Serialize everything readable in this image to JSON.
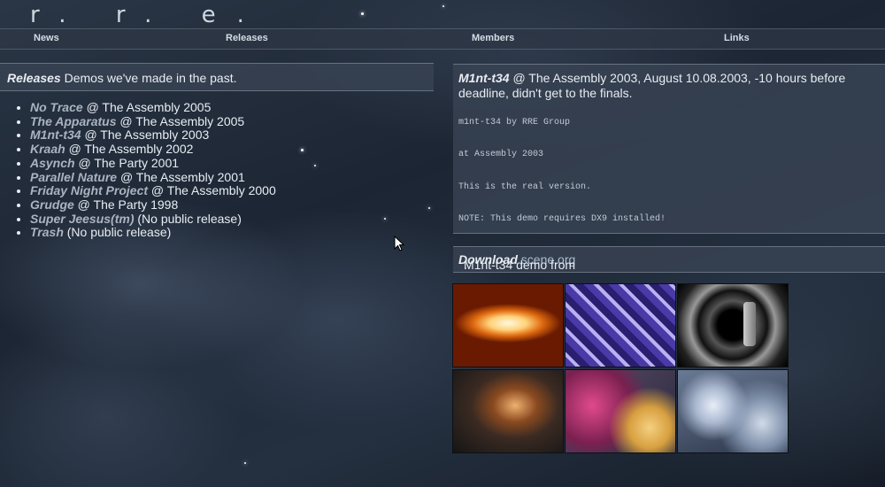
{
  "logo": "r. r. e.",
  "nav": [
    "News",
    "Releases",
    "Members",
    "Links"
  ],
  "releases_header": {
    "title": "Releases",
    "subtitle": "Demos we've made in the past."
  },
  "releases": [
    {
      "name": "No Trace",
      "info": "@ The Assembly 2005"
    },
    {
      "name": "The Apparatus",
      "info": "@ The Assembly 2005"
    },
    {
      "name": "M1nt-t34",
      "info": "@ The Assembly 2003"
    },
    {
      "name": "Kraah",
      "info": "@ The Assembly 2002"
    },
    {
      "name": "Asynch",
      "info": "@ The Party 2001"
    },
    {
      "name": "Parallel Nature",
      "info": "@ The Assembly 2001"
    },
    {
      "name": "Friday Night Project",
      "info": "@ The Assembly 2000"
    },
    {
      "name": "Grudge",
      "info": "@ The Party 1998"
    },
    {
      "name": "Super Jeesus(tm)",
      "info": "(No public release)"
    },
    {
      "name": "Trash",
      "info": "(No public release)"
    }
  ],
  "detail": {
    "name": "M1nt-t34",
    "info": "@ The Assembly 2003, August 10.08.2003, -10 hours before deadline, didn't get to the finals.",
    "lines": [
      "m1nt-t34 by RRE Group",
      "at Assembly 2003",
      "This is the real version.",
      "NOTE: This demo requires DX9 installed!"
    ]
  },
  "download": {
    "label": "Download",
    "text": "M1nt-t34 demo from",
    "link": "scene.org",
    "suffix": "."
  }
}
